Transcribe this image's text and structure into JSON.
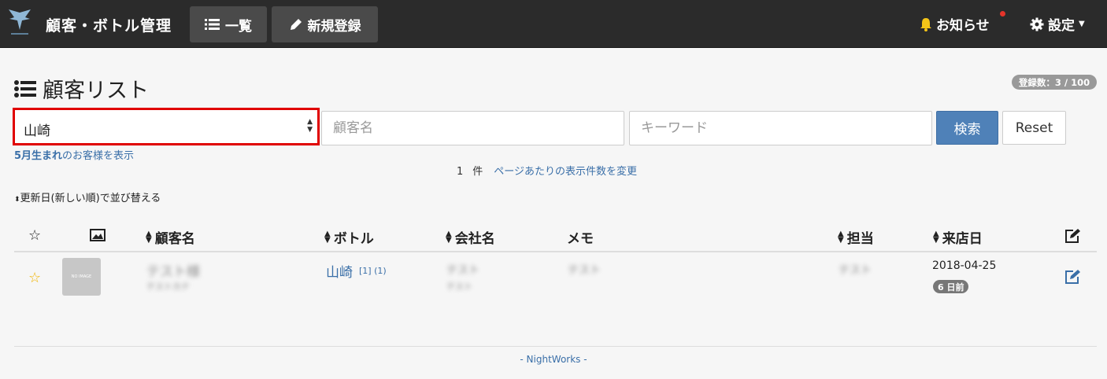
{
  "nav": {
    "brand_title": "顧客・ボトル管理",
    "list_label": "一覧",
    "new_label": "新規登録",
    "notice_label": "お知らせ",
    "settings_label": "設定"
  },
  "page": {
    "title": "顧客リスト",
    "count_badge": "登録数：3 / 100"
  },
  "search": {
    "bottle_select_value": "山崎",
    "name_placeholder": "顧客名",
    "keyword_placeholder": "キーワード",
    "search_button": "検索",
    "reset_button": "Reset"
  },
  "birthday_link": {
    "month": "5月生まれ",
    "rest": "のお客様を表示"
  },
  "paging": {
    "count": "1",
    "unit": "件",
    "change_link": "ページあたりの表示件数を変更"
  },
  "sort_link": "更新日(新しい順)で並び替える",
  "table": {
    "headers": {
      "customer_name": "顧客名",
      "bottle": "ボトル",
      "company": "会社名",
      "memo": "メモ",
      "staff": "担当",
      "visit_date": "来店日"
    },
    "rows": [
      {
        "no_image": "NO IMAGE",
        "customer_name": "テスト様",
        "customer_kana": "テストカナ",
        "bottle": "山崎",
        "bottle_counts": "[1] (1)",
        "company": "テスト",
        "company_sub": "テスト",
        "memo": "テスト",
        "staff": "テスト",
        "visit_date": "2018-04-25",
        "visit_ago": "6 日前"
      }
    ]
  },
  "footer": "- NightWorks -",
  "colors": {
    "navbar": "#2b2b2b",
    "primary": "#4f81b8",
    "link": "#3a6fa8",
    "highlight": "#e00000",
    "star": "#f0b400"
  }
}
